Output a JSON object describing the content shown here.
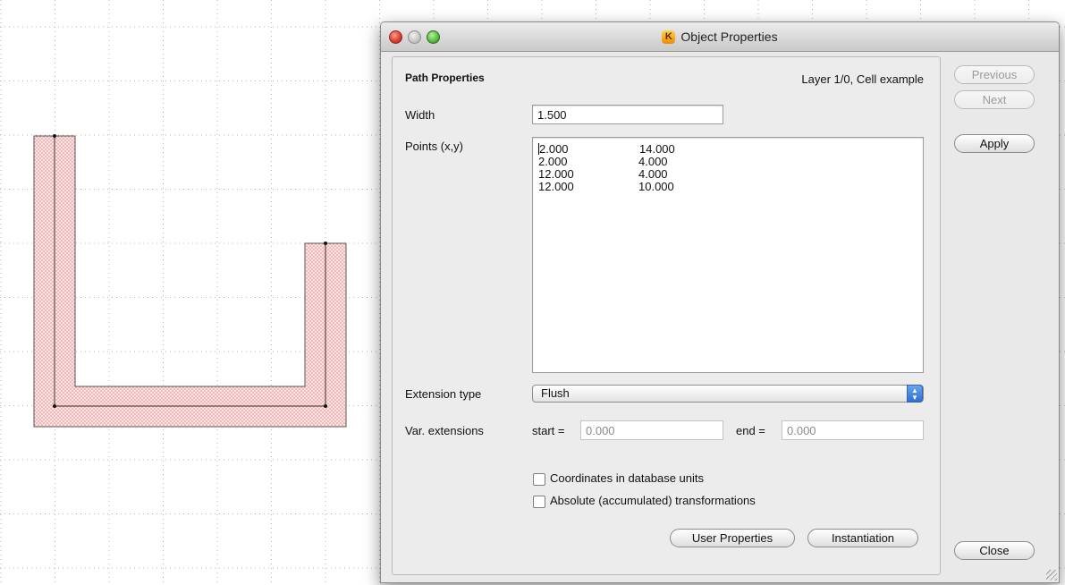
{
  "window": {
    "title": "Object Properties",
    "app_icon_glyph": "K"
  },
  "panel": {
    "heading": "Path Properties",
    "layer_info": "Layer 1/0, Cell example"
  },
  "width": {
    "label": "Width",
    "value": "1.500"
  },
  "points": {
    "label": "Points (x,y)",
    "rows": [
      {
        "x": "2.000",
        "y": "14.000"
      },
      {
        "x": "2.000",
        "y": "4.000"
      },
      {
        "x": "12.000",
        "y": "4.000"
      },
      {
        "x": "12.000",
        "y": "10.000"
      }
    ]
  },
  "extension": {
    "label": "Extension type",
    "selected": "Flush"
  },
  "var_extensions": {
    "label": "Var. extensions",
    "start_label": "start =",
    "start_value": "0.000",
    "end_label": "end =",
    "end_value": "0.000"
  },
  "checkboxes": {
    "dbu_label": "Coordinates in database units",
    "dbu_checked": false,
    "abs_label": "Absolute (accumulated) transformations",
    "abs_checked": false
  },
  "buttons": {
    "previous": "Previous",
    "next": "Next",
    "apply": "Apply",
    "user_properties": "User Properties",
    "instantiation": "Instantiation",
    "close": "Close"
  },
  "canvas": {
    "path_fill_color": "#f4c6c6",
    "grid_color": "#b8b8b8"
  }
}
